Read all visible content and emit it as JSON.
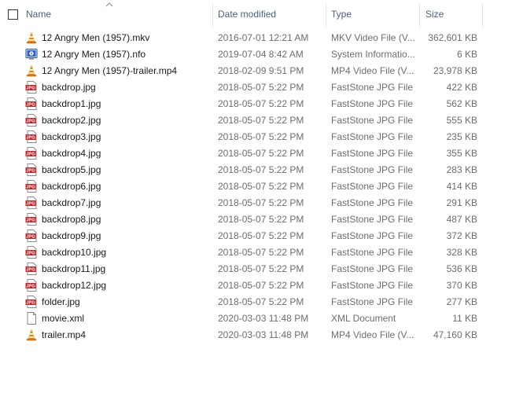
{
  "columns": {
    "name": "Name",
    "date": "Date modified",
    "type": "Type",
    "size": "Size"
  },
  "files": [
    {
      "name": "12 Angry Men (1957).mkv",
      "date": "2016-07-01 12:21 AM",
      "type": "MKV Video File (V...",
      "size": "362,601 KB",
      "icon": "vlc-cone-icon"
    },
    {
      "name": "12 Angry Men (1957).nfo",
      "date": "2019-07-04 8:42 AM",
      "type": "System Informatio...",
      "size": "6 KB",
      "icon": "system-info-icon"
    },
    {
      "name": "12 Angry Men (1957)-trailer.mp4",
      "date": "2018-02-09 9:51 PM",
      "type": "MP4 Video File (V...",
      "size": "23,978 KB",
      "icon": "vlc-cone-icon"
    },
    {
      "name": "backdrop.jpg",
      "date": "2018-05-07 5:22 PM",
      "type": "FastStone JPG File",
      "size": "422 KB",
      "icon": "jpg-file-icon"
    },
    {
      "name": "backdrop1.jpg",
      "date": "2018-05-07 5:22 PM",
      "type": "FastStone JPG File",
      "size": "562 KB",
      "icon": "jpg-file-icon"
    },
    {
      "name": "backdrop2.jpg",
      "date": "2018-05-07 5:22 PM",
      "type": "FastStone JPG File",
      "size": "555 KB",
      "icon": "jpg-file-icon"
    },
    {
      "name": "backdrop3.jpg",
      "date": "2018-05-07 5:22 PM",
      "type": "FastStone JPG File",
      "size": "235 KB",
      "icon": "jpg-file-icon"
    },
    {
      "name": "backdrop4.jpg",
      "date": "2018-05-07 5:22 PM",
      "type": "FastStone JPG File",
      "size": "355 KB",
      "icon": "jpg-file-icon"
    },
    {
      "name": "backdrop5.jpg",
      "date": "2018-05-07 5:22 PM",
      "type": "FastStone JPG File",
      "size": "283 KB",
      "icon": "jpg-file-icon"
    },
    {
      "name": "backdrop6.jpg",
      "date": "2018-05-07 5:22 PM",
      "type": "FastStone JPG File",
      "size": "414 KB",
      "icon": "jpg-file-icon"
    },
    {
      "name": "backdrop7.jpg",
      "date": "2018-05-07 5:22 PM",
      "type": "FastStone JPG File",
      "size": "291 KB",
      "icon": "jpg-file-icon"
    },
    {
      "name": "backdrop8.jpg",
      "date": "2018-05-07 5:22 PM",
      "type": "FastStone JPG File",
      "size": "487 KB",
      "icon": "jpg-file-icon"
    },
    {
      "name": "backdrop9.jpg",
      "date": "2018-05-07 5:22 PM",
      "type": "FastStone JPG File",
      "size": "372 KB",
      "icon": "jpg-file-icon"
    },
    {
      "name": "backdrop10.jpg",
      "date": "2018-05-07 5:22 PM",
      "type": "FastStone JPG File",
      "size": "328 KB",
      "icon": "jpg-file-icon"
    },
    {
      "name": "backdrop11.jpg",
      "date": "2018-05-07 5:22 PM",
      "type": "FastStone JPG File",
      "size": "536 KB",
      "icon": "jpg-file-icon"
    },
    {
      "name": "backdrop12.jpg",
      "date": "2018-05-07 5:22 PM",
      "type": "FastStone JPG File",
      "size": "370 KB",
      "icon": "jpg-file-icon"
    },
    {
      "name": "folder.jpg",
      "date": "2018-05-07 5:22 PM",
      "type": "FastStone JPG File",
      "size": "277 KB",
      "icon": "jpg-file-icon"
    },
    {
      "name": "movie.xml",
      "date": "2020-03-03 11:48 PM",
      "type": "XML Document",
      "size": "11 KB",
      "icon": "blank-document-icon"
    },
    {
      "name": "trailer.mp4",
      "date": "2020-03-03 11:48 PM",
      "type": "MP4 Video File (V...",
      "size": "47,160 KB",
      "icon": "vlc-cone-icon"
    }
  ],
  "colors": {
    "header_text": "#4c607a",
    "meta_text": "#6d6d6d",
    "jpg_badge": "#c4262e",
    "vlc_orange": "#f08a00",
    "sysinfo_blue": "#1f4e9c"
  }
}
